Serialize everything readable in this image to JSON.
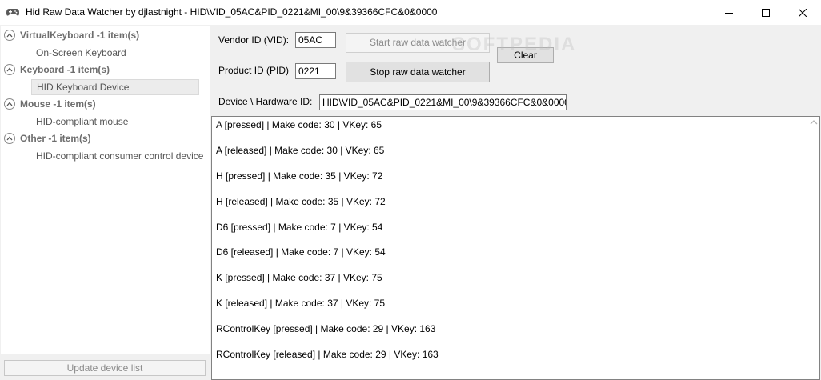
{
  "window": {
    "title": "Hid Raw Data Watcher by djlastnight - HID\\VID_05AC&PID_0221&MI_00\\9&39366CFC&0&0000"
  },
  "tree": {
    "groups": [
      {
        "label": "VirtualKeyboard -1 item(s)",
        "items": [
          "On-Screen Keyboard"
        ]
      },
      {
        "label": "Keyboard -1 item(s)",
        "items": [
          "HID Keyboard Device"
        ]
      },
      {
        "label": "Mouse -1 item(s)",
        "items": [
          "HID-compliant mouse"
        ]
      },
      {
        "label": "Other -1 item(s)",
        "items": [
          "HID-compliant consumer control device"
        ]
      }
    ],
    "selected_item": "HID Keyboard Device"
  },
  "update_button": "Update device list",
  "form": {
    "vid_label": "Vendor ID (VID):",
    "vid_value": "05AC",
    "pid_label": "Product ID (PID)",
    "pid_value": "0221",
    "hwid_label": "Device \\ Hardware ID:",
    "hwid_value": "HID\\VID_05AC&PID_0221&MI_00\\9&39366CFC&0&0000"
  },
  "buttons": {
    "start": "Start raw data watcher",
    "stop": "Stop raw data watcher",
    "clear": "Clear"
  },
  "watermark": "SOFTPEDIA",
  "log": [
    "A [pressed] | Make code: 30 | VKey: 65",
    "A [released] | Make code: 30 | VKey: 65",
    "H [pressed] | Make code: 35 | VKey: 72",
    "H [released] | Make code: 35 | VKey: 72",
    "D6 [pressed] | Make code: 7 | VKey: 54",
    "D6 [released] | Make code: 7 | VKey: 54",
    "K [pressed] | Make code: 37 | VKey: 75",
    "K [released] | Make code: 37 | VKey: 75",
    "RControlKey [pressed] | Make code: 29 | VKey: 163",
    "RControlKey [released] | Make code: 29 | VKey: 163"
  ]
}
